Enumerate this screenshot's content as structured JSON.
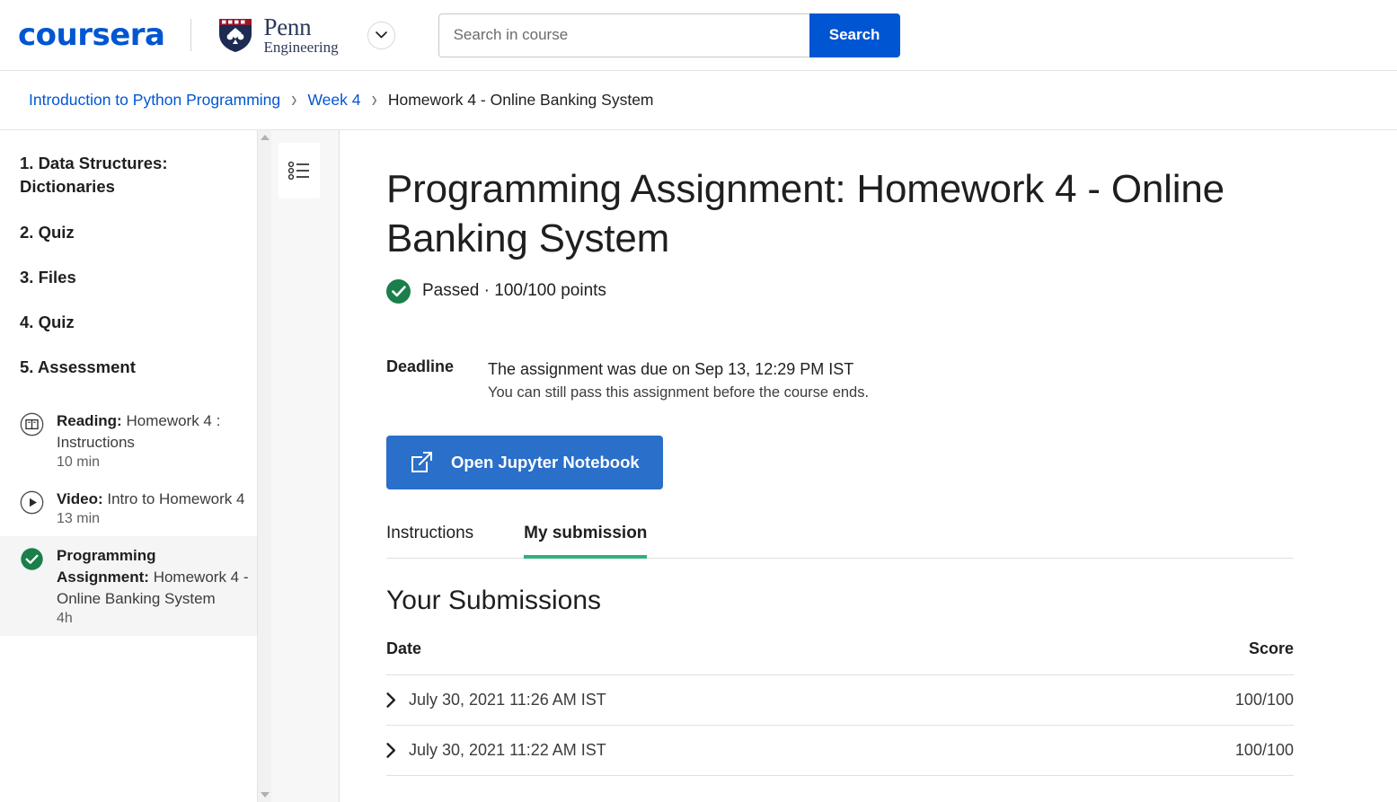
{
  "header": {
    "brand": "coursera",
    "partner_name": "Penn",
    "partner_sub": "Engineering",
    "chevron_icon": "chevron-down-icon",
    "search": {
      "value": "",
      "placeholder": "Search in course",
      "button_label": "Search"
    },
    "colors": {
      "brand_blue": "#0056D2",
      "penn_navy": "#2b3a5c",
      "penn_red": "#99162b"
    }
  },
  "breadcrumb": {
    "items": [
      {
        "label": "Introduction to Python Programming",
        "current": false
      },
      {
        "label": "Week 4",
        "current": false
      },
      {
        "label": "Homework 4 - Online Banking System",
        "current": true
      }
    ],
    "separator": "›"
  },
  "sidebar": {
    "sections": [
      {
        "label": "1. Data Structures: Dictionaries"
      },
      {
        "label": "2. Quiz"
      },
      {
        "label": "3. Files"
      },
      {
        "label": "4. Quiz"
      },
      {
        "label": "5. Assessment"
      }
    ],
    "items": [
      {
        "icon": "book-icon",
        "kind": "Reading:",
        "title": "Homework 4 : Instructions",
        "duration": "10 min",
        "active": false,
        "completed": false
      },
      {
        "icon": "play-circle-icon",
        "kind": "Video:",
        "title": "Intro to Homework 4",
        "duration": "13 min",
        "active": false,
        "completed": false
      },
      {
        "icon": "check-circle-icon",
        "kind": "Programming Assignment:",
        "title": "Homework 4 - Online Banking System",
        "duration": "4h",
        "active": true,
        "completed": true
      }
    ],
    "scroll_up_icon": "scroll-up-arrow-icon",
    "scroll_down_icon": "scroll-down-arrow-icon"
  },
  "rail": {
    "outline_icon": "bulleted-list-icon"
  },
  "main": {
    "title": "Programming Assignment: Homework 4 - Online Banking System",
    "status": {
      "icon": "check-circle-icon",
      "text": "Passed · 100/100 points",
      "color": "#1a7f4b"
    },
    "deadline": {
      "label": "Deadline",
      "primary": "The assignment was due on Sep 13, 12:29 PM IST",
      "secondary": "You can still pass this assignment before the course ends."
    },
    "open_button": {
      "label": "Open Jupyter Notebook",
      "icon": "external-link-icon",
      "color": "#2a6fc9"
    },
    "tabs": [
      {
        "label": "Instructions",
        "active": false
      },
      {
        "label": "My submission",
        "active": true
      }
    ],
    "tab_accent_color": "#2fb17c",
    "submissions": {
      "heading": "Your Submissions",
      "columns": [
        "Date",
        "Score"
      ],
      "rows": [
        {
          "expand_icon": "chevron-right-icon",
          "date": "July 30, 2021 11:26 AM IST",
          "score": "100/100"
        },
        {
          "expand_icon": "chevron-right-icon",
          "date": "July 30, 2021 11:22 AM IST",
          "score": "100/100"
        }
      ]
    }
  }
}
